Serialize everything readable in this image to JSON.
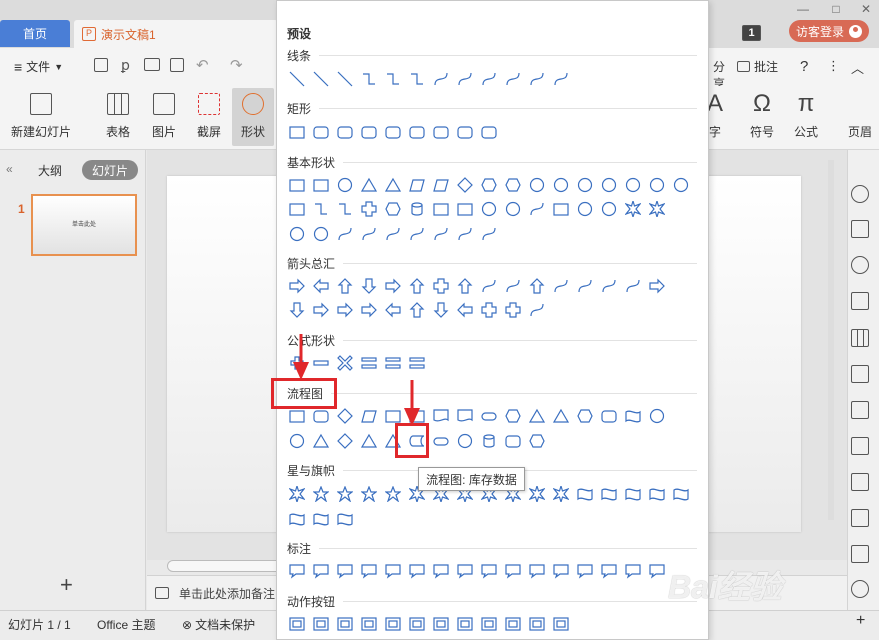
{
  "titlebar": {
    "home_tab": "首页",
    "doc_tab": "演示文稿1",
    "doc_icon": "P",
    "badge": "1",
    "login": "访客登录",
    "window_controls": [
      "minimize-icon",
      "maximize-icon",
      "close-icon"
    ]
  },
  "menubar": {
    "file": "文件",
    "share": "分享",
    "comment": "批注",
    "help_icon": "?"
  },
  "ribbon": {
    "new_slide": "新建幻灯片",
    "table": "表格",
    "image": "图片",
    "screenshot": "截屏",
    "shape": "形状",
    "art_text": "字",
    "symbol": "符号",
    "formula": "公式",
    "header_footer": "页眉",
    "symbol_glyph": "Ω",
    "formula_glyph": "π"
  },
  "left_panel": {
    "outline_tab": "大纲",
    "slides_tab": "幻灯片",
    "slide_number": "1",
    "thumb_title": "单击此处",
    "add_icon": "+"
  },
  "notes": {
    "placeholder": "单击此处添加备注"
  },
  "statusbar": {
    "slide_info": "幻灯片 1 / 1",
    "theme": "Office 主题",
    "protect": "文档未保护"
  },
  "dropdown": {
    "preset": "预设",
    "sections": {
      "lines": "线条",
      "rect": "矩形",
      "basic": "基本形状",
      "arrows": "箭头总汇",
      "formula": "公式形状",
      "flowchart": "流程图",
      "stars": "星与旗帜",
      "callouts": "标注",
      "action": "动作按钮"
    },
    "tooltip": "流程图: 库存数据"
  },
  "watermark": "Bai经验",
  "colors": {
    "accent": "#4a7ed6",
    "shape": "#3a6fc0",
    "highlight": "#e0282b",
    "doc_tab": "#d9622b"
  }
}
